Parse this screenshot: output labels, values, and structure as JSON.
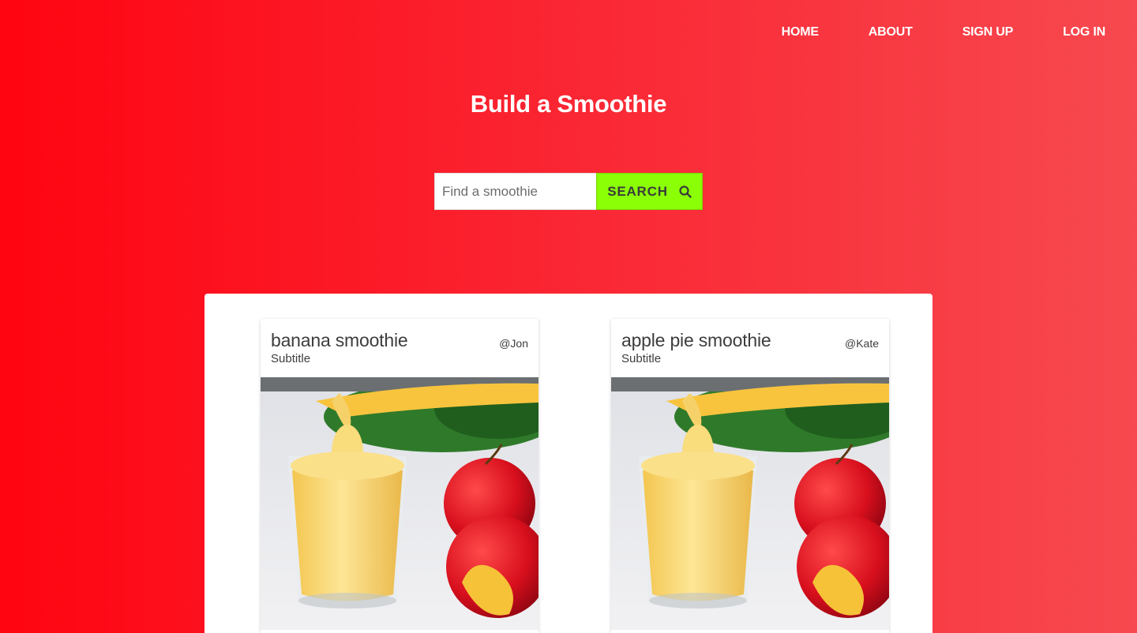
{
  "nav": {
    "items": [
      {
        "label": "HOME"
      },
      {
        "label": "ABOUT"
      },
      {
        "label": "SIGN UP"
      },
      {
        "label": "LOG IN"
      }
    ]
  },
  "hero": {
    "title": "Build a Smoothie"
  },
  "search": {
    "placeholder": "Find a smoothie",
    "value": "",
    "button_label": "SEARCH",
    "icon": "search-icon"
  },
  "cards": [
    {
      "title": "banana smoothie",
      "subtitle": "Subtitle",
      "author": "@Jon",
      "image": "smoothie-with-apples-photo"
    },
    {
      "title": "apple pie smoothie",
      "subtitle": "Subtitle",
      "author": "@Kate",
      "image": "smoothie-with-apples-photo"
    }
  ],
  "colors": {
    "gradient_start": "#ff0411",
    "gradient_end": "#f7494f",
    "search_button": "#8aff05",
    "text_dark": "#3d3d3d",
    "white": "#ffffff"
  }
}
